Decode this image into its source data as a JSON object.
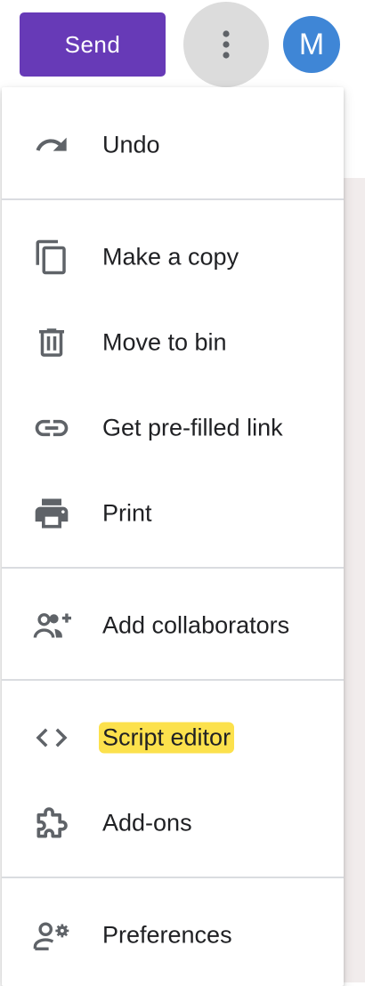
{
  "toolbar": {
    "send_label": "Send",
    "avatar_initial": "M",
    "accent_color": "#673ab7",
    "avatar_color": "#3f86d6"
  },
  "menu": {
    "items": [
      {
        "label": "Undo",
        "icon": "undo-icon"
      },
      {
        "label": "Make a copy",
        "icon": "copy-icon"
      },
      {
        "label": "Move to bin",
        "icon": "trash-icon"
      },
      {
        "label": "Get pre-filled link",
        "icon": "link-icon"
      },
      {
        "label": "Print",
        "icon": "printer-icon"
      },
      {
        "label": "Add collaborators",
        "icon": "add-people-icon"
      },
      {
        "label": "Script editor",
        "icon": "code-icon",
        "highlighted": true
      },
      {
        "label": "Add-ons",
        "icon": "puzzle-icon"
      },
      {
        "label": "Preferences",
        "icon": "person-settings-icon"
      }
    ],
    "highlight_color": "#fce14c"
  }
}
